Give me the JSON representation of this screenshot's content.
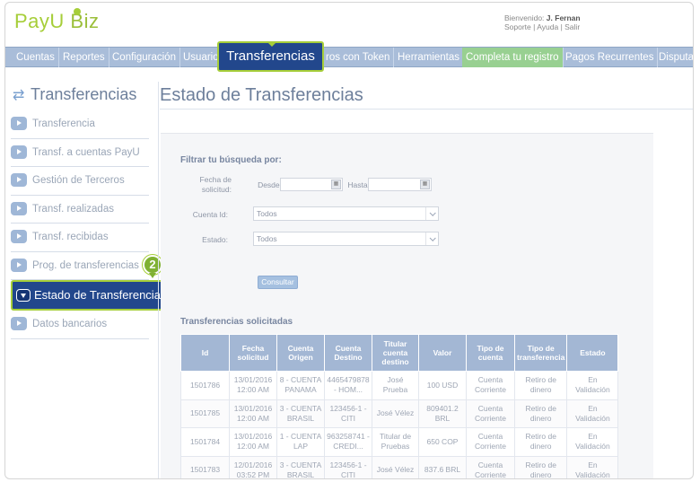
{
  "header": {
    "logo_main": "PayU",
    "logo_sub": "Biz",
    "greeting": "Bienvenido:",
    "user_name": "J. Fernan",
    "links": [
      "Soporte",
      "Ayuda",
      "Salir"
    ]
  },
  "nav": {
    "items": [
      "Cuentas",
      "Reportes",
      "Configuración",
      "Usuario",
      "ros con Token",
      "Herramientas",
      "Completa tu registro",
      "Pagos Recurrentes",
      "Disputa"
    ],
    "active": "Transferencias"
  },
  "sidebar": {
    "title": "Transferencias",
    "items": [
      {
        "label": "Transferencia"
      },
      {
        "label": "Transf. a cuentas PayU"
      },
      {
        "label": "Gestión de Terceros"
      },
      {
        "label": "Transf. realizadas"
      },
      {
        "label": "Transf. recibidas"
      },
      {
        "label": "Prog. de transferencias"
      },
      {
        "label": "Estado de Transferencias"
      },
      {
        "label": "Datos bancarios"
      }
    ],
    "step_badge": "2"
  },
  "main": {
    "title": "Estado de Transferencias",
    "filter_heading": "Filtrar tu búsqueda por:",
    "fecha_label_1": "Fecha de",
    "fecha_label_2": "solicitud:",
    "desde_label": "Desde:",
    "hasta_label": "Hasta:",
    "desde_value": "",
    "hasta_value": "",
    "cuenta_label": "Cuenta Id:",
    "cuenta_value": "Todos",
    "estado_label": "Estado:",
    "estado_value": "Todos",
    "consultar_label": "Consultar",
    "table_heading": "Transferencias solicitadas"
  },
  "table": {
    "columns": [
      "Id",
      "Fecha solicitud",
      "Cuenta Origen",
      "Cuenta Destino",
      "Titular cuenta destino",
      "Valor",
      "Tipo de cuenta",
      "Tipo de transferencia",
      "Estado"
    ],
    "rows": [
      [
        "1501786",
        "13/01/2016\n12:00 AM",
        "8 - CUENTA\nPANAMA",
        "4465479878\n- HOM...",
        "José Prueba",
        "100 USD",
        "Cuenta\nCorriente",
        "Retiro de\ndinero",
        "En\nValidación"
      ],
      [
        "1501785",
        "13/01/2016\n12:00 AM",
        "3 - CUENTA\nBRASIL",
        "123456-1 -\nCITI",
        "José Vélez",
        "809401.2\nBRL",
        "Cuenta\nCorriente",
        "Retiro de\ndinero",
        "En\nValidación"
      ],
      [
        "1501784",
        "13/01/2016\n12:00 AM",
        "1 - CUENTA\nLAP",
        "963258741 -\nCREDI...",
        "Titular de\nPruebas",
        "650 COP",
        "Cuenta\nCorriente",
        "Retiro de\ndinero",
        "En\nValidación"
      ],
      [
        "1501783",
        "12/01/2016\n03:52 PM",
        "3 - CUENTA\nBRASIL",
        "123456-1 -\nCITI",
        "José Vélez",
        "837.6 BRL",
        "Cuenta\nCorriente",
        "Retiro de\ndinero",
        "En\nValidación"
      ]
    ]
  },
  "colors": {
    "brand_green": "#a6ce39",
    "nav_blue": "#a9bdd9",
    "active_navy": "#22478c",
    "register_green": "#98d091"
  },
  "icons": {
    "sidebar_title": "refresh-arrows-icon",
    "sidebar_item": "play-arrow-icon",
    "calendar": "calendar-icon",
    "dropdown": "chevron-down-icon"
  }
}
